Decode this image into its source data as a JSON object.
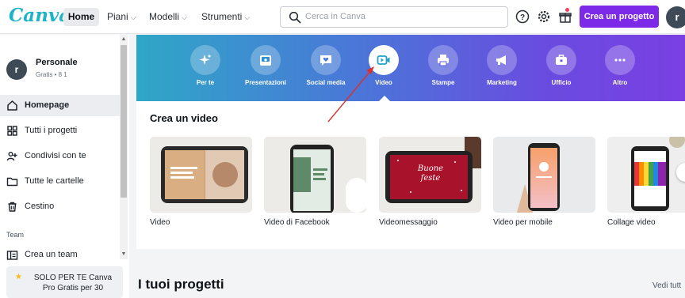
{
  "header": {
    "logo": "Canva",
    "nav": [
      {
        "label": "Home"
      },
      {
        "label": "Piani"
      },
      {
        "label": "Modelli"
      },
      {
        "label": "Strumenti"
      }
    ],
    "search_placeholder": "Cerca in Canva",
    "create_button": "Crea un progetto",
    "avatar_initial": "r"
  },
  "sidebar": {
    "account": {
      "name": "Personale",
      "subtitle": "Gratis • 8 1",
      "initial": "r"
    },
    "items": [
      {
        "label": "Homepage",
        "icon": "home-icon",
        "active": true
      },
      {
        "label": "Tutti i progetti",
        "icon": "grid-icon"
      },
      {
        "label": "Condivisi con te",
        "icon": "people-icon"
      },
      {
        "label": "Tutte le cartelle",
        "icon": "folder-icon"
      },
      {
        "label": "Cestino",
        "icon": "trash-icon"
      }
    ],
    "team_label": "Team",
    "team_item": {
      "label": "Crea un team",
      "icon": "team-icon"
    },
    "promo": {
      "line1": "SOLO PER TE Canva",
      "line2": "Pro Gratis per 30"
    }
  },
  "categories": [
    {
      "label": "Per te",
      "icon": "sparkle-icon"
    },
    {
      "label": "Presentazioni",
      "icon": "presentation-icon"
    },
    {
      "label": "Social media",
      "icon": "heart-chat-icon"
    },
    {
      "label": "Video",
      "icon": "video-camera-icon",
      "selected": true
    },
    {
      "label": "Stampe",
      "icon": "printer-icon"
    },
    {
      "label": "Marketing",
      "icon": "megaphone-icon"
    },
    {
      "label": "Ufficio",
      "icon": "briefcase-icon"
    },
    {
      "label": "Altro",
      "icon": "more-icon"
    }
  ],
  "video_section": {
    "title": "Crea un video",
    "cards": [
      {
        "label": "Video"
      },
      {
        "label": "Video di Facebook"
      },
      {
        "label": "Videomessaggio",
        "thumb_text": "Buone feste"
      },
      {
        "label": "Video per mobile"
      },
      {
        "label": "Collage video"
      }
    ]
  },
  "projects": {
    "title": "I tuoi progetti",
    "see_all": "Vedi tutt"
  },
  "colors": {
    "brand_purple": "#7d2ae8",
    "logo_teal": "#1eb3c7",
    "annotation_arrow": "#d9322b"
  }
}
